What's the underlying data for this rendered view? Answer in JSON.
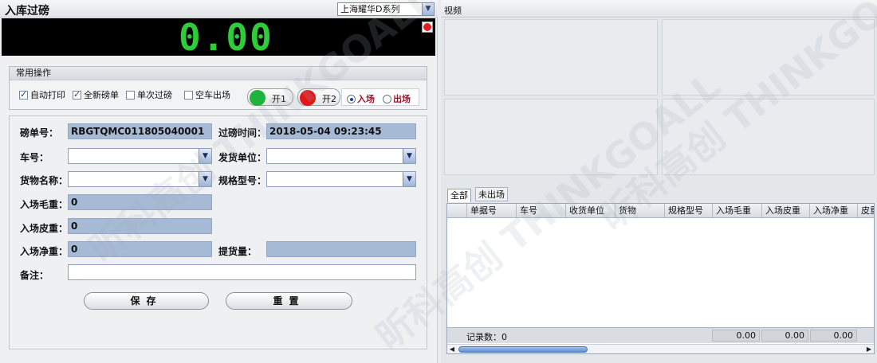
{
  "left_panel": {
    "title": "入库过磅",
    "scale_select": "上海耀华D系列",
    "weight_display": "0.00",
    "ops": {
      "title": "常用操作",
      "checkboxes": [
        {
          "label": "自动打印",
          "checked": true
        },
        {
          "label": "全新磅单",
          "checked": true
        },
        {
          "label": "单次过磅",
          "checked": false
        },
        {
          "label": "空车出场",
          "checked": false
        }
      ],
      "switch1": "开1",
      "switch2": "开2",
      "switch1_color": "#1db33c",
      "switch2_color": "#e01818",
      "radio_in": "入场",
      "radio_out": "出场",
      "selected_direction": "入场"
    },
    "form": {
      "ticket_no_label": "磅单号：",
      "ticket_no": "RBGTQMC011805040001",
      "time_label": "过磅时间：",
      "time": "2018-05-04 09:23:45",
      "car_label": "车号：",
      "sender_label": "发货单位：",
      "goods_label": "货物名称：",
      "spec_label": "规格型号：",
      "gross_label": "入场毛重：",
      "gross": "0",
      "tare_label": "入场皮重：",
      "tare": "0",
      "net_label": "入场净重：",
      "net": "0",
      "pickup_label": "提货量：",
      "remark_label": "备注："
    },
    "buttons": {
      "save": "保存",
      "reset": "重置"
    }
  },
  "right_panel": {
    "video_title": "视频",
    "tabs": [
      "全部",
      "未出场"
    ],
    "columns": [
      "单据号",
      "车号",
      "收货单位",
      "货物",
      "规格型号",
      "入场毛重",
      "入场皮重",
      "入场净重",
      "皮重"
    ],
    "footer": {
      "record_count": "记录数：0",
      "sum1": "0.00",
      "sum2": "0.00",
      "sum3": "0.00"
    }
  },
  "watermark": "昕科高创 THINKGOALL"
}
